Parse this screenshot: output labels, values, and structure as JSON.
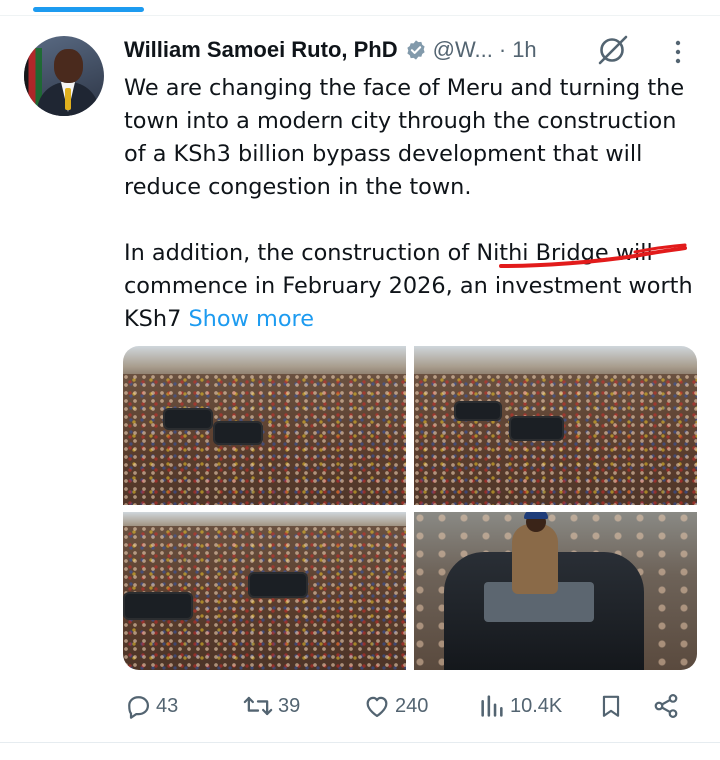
{
  "post": {
    "author": {
      "name": "William Samoei Ruto, PhD",
      "handle": "@W...",
      "verified_icon": "verified-badge-icon",
      "time": "1h"
    },
    "separator": "·",
    "text": {
      "paragraph1": "We are changing the face of Meru and turning the town into a modern city through the construction of a KSh3 billion bypass development that will reduce congestion in the town.",
      "paragraph2": "In addition, the construction of Nithi Bridge will commence in February 2026, an investment worth KSh7",
      "show_more": "Show more"
    },
    "media": {
      "photo_count": 4,
      "photos": [
        "crowd-photo-1",
        "crowd-photo-2",
        "crowd-photo-3",
        "rally-vehicle-photo"
      ]
    }
  },
  "actions": {
    "replies": "43",
    "reposts": "39",
    "likes": "240",
    "views": "10.4K"
  },
  "icons": [
    "grok-icon",
    "more-options-icon",
    "reply-icon",
    "retweet-icon",
    "heart-icon",
    "views-icon",
    "bookmark-icon",
    "share-icon"
  ],
  "colors": {
    "accent": "#1d9bf0",
    "muted": "#536471",
    "text": "#0f1419",
    "annotation": "#e21b1b"
  }
}
